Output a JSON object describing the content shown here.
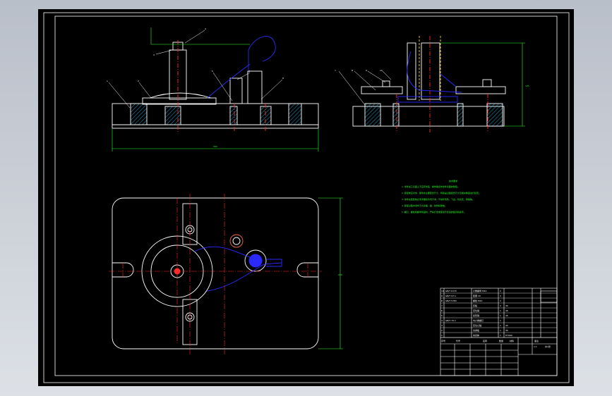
{
  "drawing": {
    "balloons_front": [
      "1",
      "2",
      "3",
      "4",
      "5",
      "6",
      "7",
      "8"
    ],
    "balloons_side": [
      "7",
      "8",
      "9",
      "10"
    ],
    "dims": {
      "width": "300",
      "height": "125",
      "plan_height": "200"
    },
    "tech_title": "技术要求",
    "tech_lines": [
      "1. 零件加工表面上不应有划痕、擦伤等损伤零件表面的缺陷。",
      "2. 装配前应对零、部件的主要配合尺寸，特别是过盈配合尺寸及相关精度进行复查。",
      "3. 零件在装配前必须清理和清洗干净，不得有毛刺、飞边、氧化皮、锈蚀等。",
      "4. 装配过程中零件不允许磕、碰、划伤和锈蚀。",
      "5. 螺钉、螺栓和螺母紧固时，严禁打击或使用不合适的旋具和扳手。"
    ],
    "colors": {
      "outline": "#ffffff",
      "dimension": "#28ff28",
      "leader": "#ffffff",
      "centerline": "#ff2a2a",
      "hidden": "#ffd200",
      "section": "#22c8ff",
      "phantom": "#2a2aff"
    }
  },
  "title_block": {
    "bom_rows": [
      [
        "10",
        "GB/T 6170",
        "六角螺母 M10",
        "2",
        "",
        ""
      ],
      [
        "9",
        "GB/T 97.1",
        "垫圈 10",
        "2",
        "",
        ""
      ],
      [
        "8",
        "GB/T 5783",
        "螺栓 M10",
        "2",
        "",
        ""
      ],
      [
        "7",
        "",
        "压板",
        "2",
        "45",
        ""
      ],
      [
        "6",
        "",
        "定位销",
        "1",
        "45",
        ""
      ],
      [
        "5",
        "",
        "菱形销",
        "1",
        "45",
        ""
      ],
      [
        "4",
        "GB/T 70.1",
        "内六角螺钉",
        "1",
        "",
        ""
      ],
      [
        "3",
        "",
        "定位心轴",
        "1",
        "45",
        ""
      ],
      [
        "2",
        "",
        "支承板",
        "1",
        "45",
        ""
      ],
      [
        "1",
        "",
        "夹具体",
        "1",
        "HT200",
        ""
      ]
    ],
    "headers": [
      "序号",
      "代号",
      "名称",
      "数量",
      "材料",
      "备注"
    ],
    "scale_label": "1:1",
    "sheet_label": "共1张"
  }
}
